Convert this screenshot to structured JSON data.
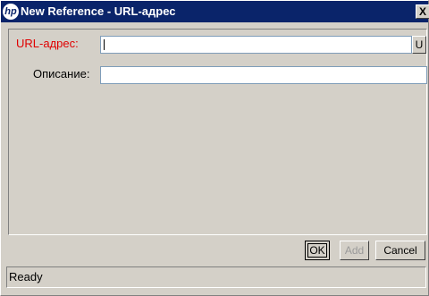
{
  "window": {
    "title": "New Reference - URL-адрес",
    "close_label": "X",
    "logo_label": "hp"
  },
  "form": {
    "url_label": "URL-адрес:",
    "url_value": "",
    "url_button_label": "U",
    "description_label": "Описание:",
    "description_value": ""
  },
  "buttons": {
    "ok_label": "OK",
    "add_label": "Add",
    "cancel_label": "Cancel"
  },
  "status": {
    "text": "Ready"
  },
  "colors": {
    "titlebar": "#0a246a",
    "required_label": "#e00000",
    "background": "#d4d0c8"
  }
}
